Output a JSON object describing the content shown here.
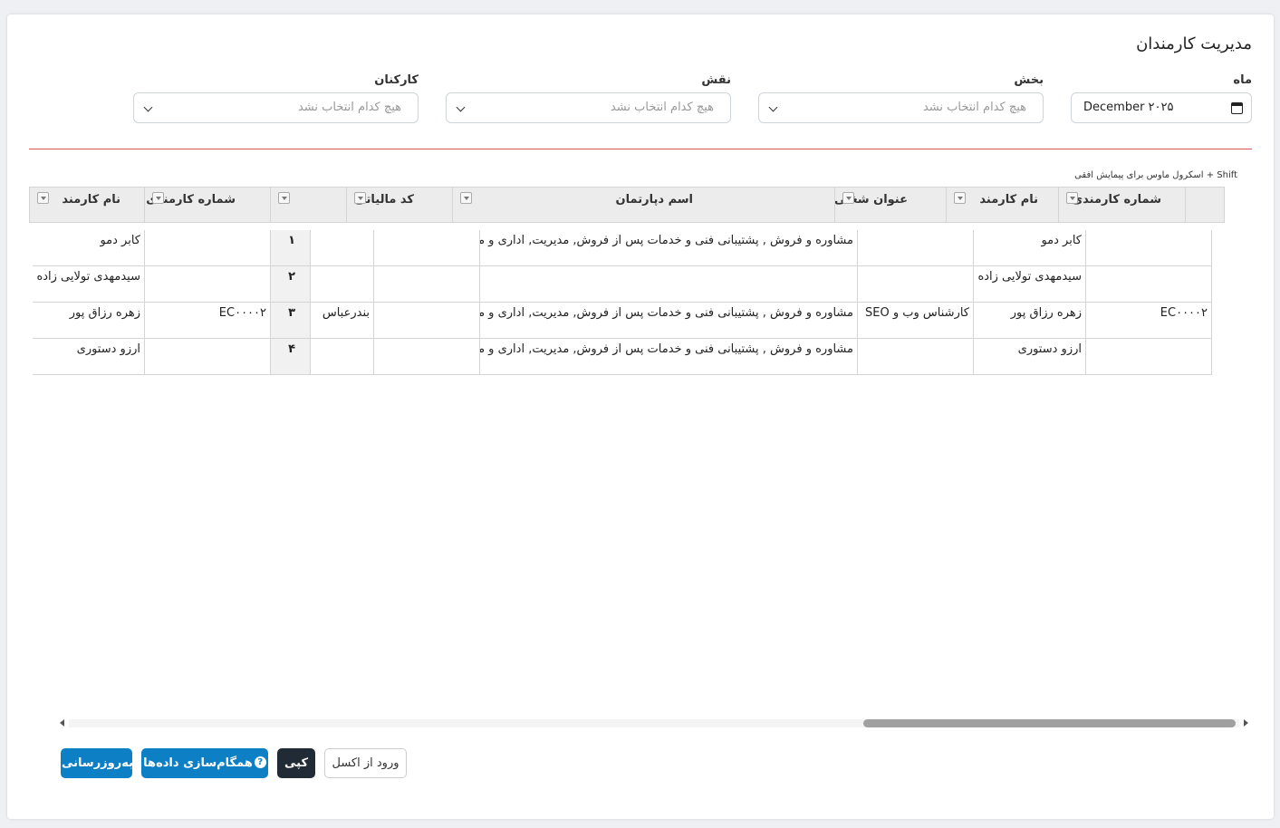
{
  "page": {
    "title": "مدیریت کارمندان"
  },
  "filters": {
    "month": {
      "label": "ماه",
      "value": "December ۲۰۲۵"
    },
    "department": {
      "label": "بخش",
      "placeholder": "هیچ کدام انتخاب نشد"
    },
    "role": {
      "label": "نقش",
      "placeholder": "هیچ کدام انتخاب نشد"
    },
    "staff": {
      "label": "کارکنان",
      "placeholder": "هیچ کدام انتخاب نشد"
    }
  },
  "grid": {
    "hint": "Shift + اسکرول ماوس برای پیمایش افقی",
    "headers": {
      "employee_number_right": "شماره کارمندی",
      "employee_name_right": "نام کارمند",
      "job_title": "عنوان شغلی",
      "department_name": "اسم دپارتمان",
      "tax_code": "کد مالیاتی",
      "index": "",
      "employee_number_left": "شماره کارمندی",
      "employee_name_left": "نام کارمند"
    },
    "rows": [
      {
        "emp_no": "",
        "emp_name": "کابر دمو",
        "job": "",
        "dept": "مشاوره و فروش , پشتیبانی فنی و خدمات پس از فروش, مدیریت, اداری و مالی",
        "tax": "",
        "city": "",
        "idx": "۱",
        "emp_no_left": "",
        "emp_name_left": "کابر دمو"
      },
      {
        "emp_no": "",
        "emp_name": "سیدمهدی تولایی زاده",
        "job": "",
        "dept": "",
        "tax": "",
        "city": "",
        "idx": "۲",
        "emp_no_left": "",
        "emp_name_left": "سیدمهدی تولایی زاده"
      },
      {
        "emp_no": "EC۰۰۰۰۲",
        "emp_name": "زهره رزاق پور",
        "job": "کارشناس وب و SEO",
        "dept": "مشاوره و فروش , پشتیبانی فنی و خدمات پس از فروش, مدیریت, اداری و مالی",
        "tax": "",
        "city": "بندرعباس",
        "idx": "۳",
        "emp_no_left": "EC۰۰۰۰۲",
        "emp_name_left": "زهره رزاق پور"
      },
      {
        "emp_no": "",
        "emp_name": "ارزو دستوری",
        "job": "",
        "dept": "مشاوره و فروش , پشتیبانی فنی و خدمات پس از فروش, مدیریت, اداری و مالی",
        "tax": "",
        "city": "",
        "idx": "۴",
        "emp_no_left": "",
        "emp_name_left": "ارزو دستوری"
      }
    ]
  },
  "actions": {
    "refresh": "به‌روزرسانی",
    "sync": "همگام‌سازی داده‌ها",
    "sync_help": "?",
    "copy": "کپی",
    "import_excel": "ورود از اکسل"
  },
  "colors": {
    "primary": "#0d80c5",
    "dark": "#212b36",
    "divider": "#d9534f"
  }
}
